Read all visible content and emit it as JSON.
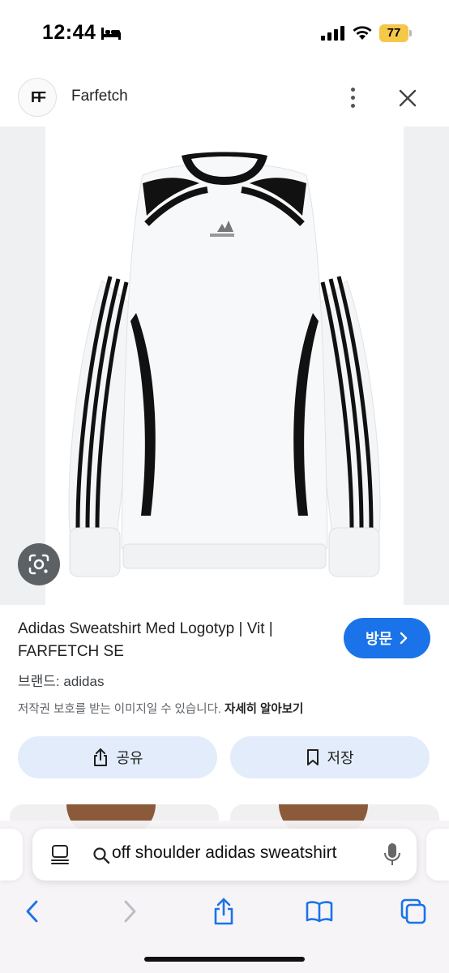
{
  "status_bar": {
    "time": "12:44",
    "battery_level": "77",
    "battery_color": "#f5c84a"
  },
  "sheet": {
    "site_logo_text": "FF",
    "site_name": "Farfetch"
  },
  "product": {
    "image_alt": "Adidas white sweatshirt with black stripes, cold-shoulder cutouts",
    "title": "Adidas Sweatshirt Med Logotyp | Vit | FARFETCH SE",
    "visit_label": "방문",
    "brand": "브랜드: adidas",
    "copyright_notice": "저작권 보호를 받는 이미지일 수 있습니다.",
    "learn_more": "자세히 알아보기",
    "share_label": "공유",
    "save_label": "저장"
  },
  "browser": {
    "address_text": "off shoulder adidas sweatshirt",
    "accent_color": "#1a73e8",
    "icons": [
      "page-menu-icon",
      "search-icon",
      "mic-icon",
      "back-icon",
      "forward-icon",
      "share-icon",
      "bookmarks-icon",
      "tabs-icon"
    ]
  }
}
